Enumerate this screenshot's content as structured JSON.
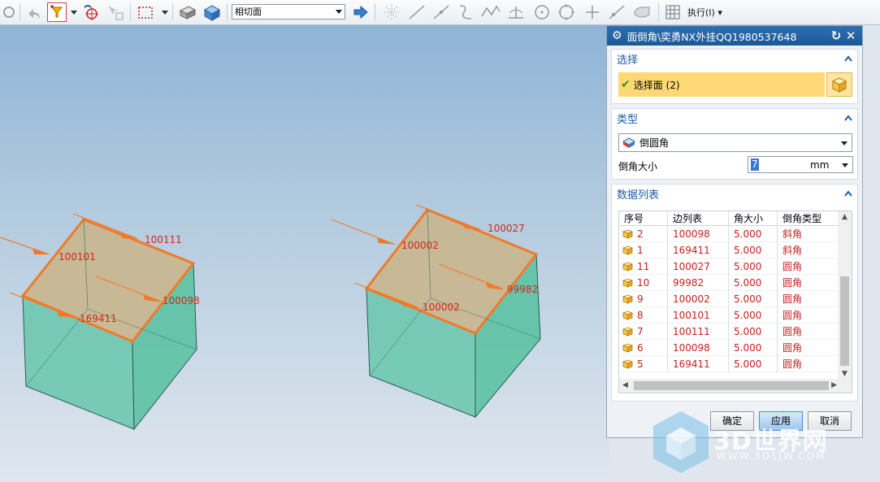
{
  "toolbar": {
    "filter_select_value": "相切面",
    "exec_menu_label": "执行(I)"
  },
  "viewport": {
    "left_cube_edges": [
      "100111",
      "100101",
      "100098",
      "169411"
    ],
    "right_cube_edges": [
      "100027",
      "100002",
      "99982",
      "100002"
    ]
  },
  "dialog": {
    "title": "面倒角\\奕勇NX外挂QQ1980537648",
    "select_group": {
      "header": "选择",
      "select_face_label": "选择面 (2)"
    },
    "type_group": {
      "header": "类型",
      "type_value": "倒圆角",
      "size_label": "倒角大小",
      "size_value": "7",
      "size_unit": "mm"
    },
    "list_group": {
      "header": "数据列表",
      "columns": [
        "序号",
        "边列表",
        "角大小",
        "倒角类型"
      ],
      "rows": [
        {
          "no": "2",
          "edge": "100098",
          "size": "5.000",
          "kind": "斜角"
        },
        {
          "no": "1",
          "edge": "169411",
          "size": "5.000",
          "kind": "斜角"
        },
        {
          "no": "11",
          "edge": "100027",
          "size": "5.000",
          "kind": "圆角"
        },
        {
          "no": "10",
          "edge": "99982",
          "size": "5.000",
          "kind": "圆角"
        },
        {
          "no": "9",
          "edge": "100002",
          "size": "5.000",
          "kind": "圆角"
        },
        {
          "no": "8",
          "edge": "100101",
          "size": "5.000",
          "kind": "圆角"
        },
        {
          "no": "7",
          "edge": "100111",
          "size": "5.000",
          "kind": "圆角"
        },
        {
          "no": "6",
          "edge": "100098",
          "size": "5.000",
          "kind": "圆角"
        },
        {
          "no": "5",
          "edge": "169411",
          "size": "5.000",
          "kind": "圆角"
        }
      ]
    },
    "buttons": {
      "ok": "确定",
      "apply": "应用",
      "cancel": "取消"
    }
  },
  "watermark": {
    "brand": "3D世界网",
    "url": "WWW.3DSJW.COM"
  },
  "colors": {
    "title_bar": "#1c5899",
    "group_header_text": "#1f5da8",
    "selection_highlight": "#fdd874",
    "row_text": "#c81e1e",
    "edge_highlight": "#f07a2a",
    "cube_side": "#6ec8b0"
  }
}
